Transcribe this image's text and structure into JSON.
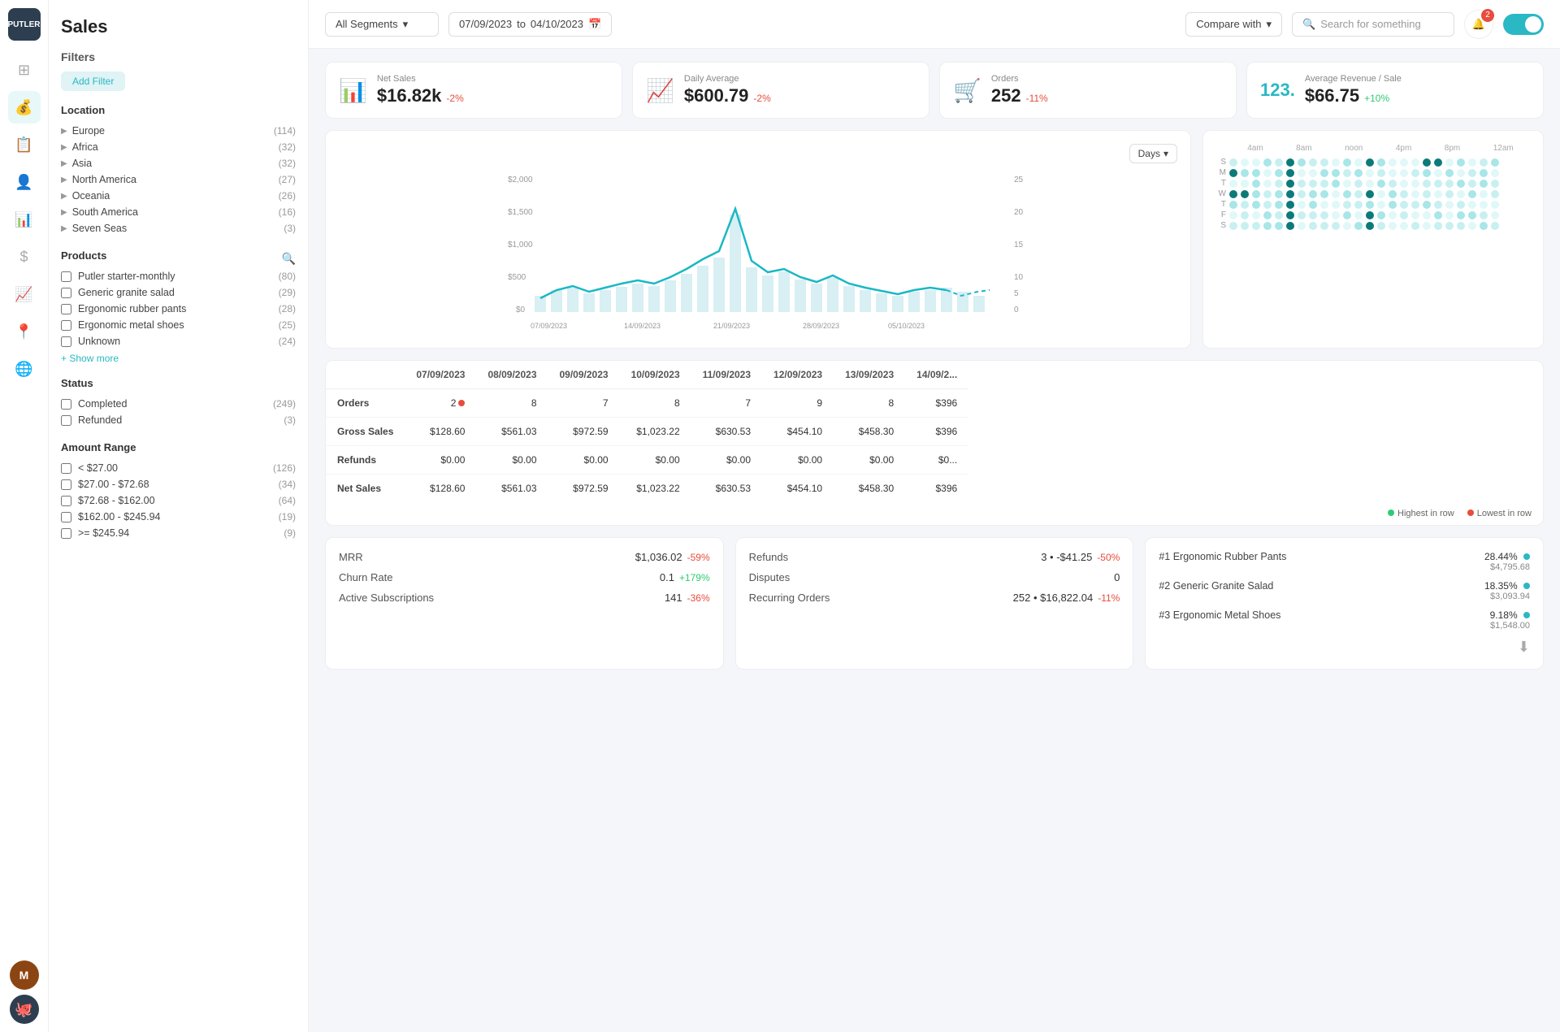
{
  "app": {
    "name": "PUTLER",
    "page_title": "Sales"
  },
  "topbar": {
    "segment_label": "All Segments",
    "date_from": "07/09/2023",
    "date_to": "04/10/2023",
    "compare_label": "Compare with",
    "search_placeholder": "Search for something",
    "notification_count": "2"
  },
  "kpis": [
    {
      "id": "net-sales",
      "label": "Net Sales",
      "value": "$16.82k",
      "change": "-2%",
      "positive": false
    },
    {
      "id": "daily-avg",
      "label": "Daily Average",
      "value": "$600.79",
      "change": "-2%",
      "positive": false
    },
    {
      "id": "orders",
      "label": "Orders",
      "value": "252",
      "change": "-11%",
      "positive": false
    },
    {
      "id": "avg-revenue",
      "label": "Average Revenue / Sale",
      "value": "$66.75",
      "change": "+10%",
      "positive": true
    }
  ],
  "filters": {
    "title": "Filters",
    "add_button": "Add Filter",
    "location": {
      "title": "Location",
      "items": [
        {
          "label": "Europe",
          "count": 114
        },
        {
          "label": "Africa",
          "count": 32
        },
        {
          "label": "Asia",
          "count": 32
        },
        {
          "label": "North America",
          "count": 27
        },
        {
          "label": "Oceania",
          "count": 26
        },
        {
          "label": "South America",
          "count": 16
        },
        {
          "label": "Seven Seas",
          "count": 3
        }
      ]
    },
    "products": {
      "title": "Products",
      "items": [
        {
          "label": "Putler starter-monthly",
          "count": 80
        },
        {
          "label": "Generic granite salad",
          "count": 29
        },
        {
          "label": "Ergonomic rubber pants",
          "count": 28
        },
        {
          "label": "Ergonomic metal shoes",
          "count": 25
        },
        {
          "label": "Unknown",
          "count": 24
        }
      ],
      "show_more": "+ Show more"
    },
    "status": {
      "title": "Status",
      "items": [
        {
          "label": "Completed",
          "count": 249
        },
        {
          "label": "Refunded",
          "count": 3
        }
      ]
    },
    "amount_range": {
      "title": "Amount Range",
      "items": [
        {
          "label": "< $27.00",
          "count": 126
        },
        {
          "label": "$27.00 - $72.68",
          "count": 34
        },
        {
          "label": "$72.68 - $162.00",
          "count": 64
        },
        {
          "label": "$162.00 - $245.94",
          "count": 19
        },
        {
          "label": ">= $245.94",
          "count": 9
        }
      ]
    }
  },
  "chart": {
    "days_button": "Days",
    "x_labels": [
      "07/09/2023",
      "14/09/2023",
      "21/09/2023",
      "28/09/2023",
      "05/10/2023"
    ],
    "y_labels": [
      "$2,000",
      "$1,500",
      "$1,000",
      "$500",
      "$0"
    ],
    "y_right_labels": [
      "25",
      "20",
      "15",
      "10",
      "5",
      "0"
    ]
  },
  "heatmap": {
    "time_labels": [
      "4am",
      "8am",
      "noon",
      "4pm",
      "8pm",
      "12am"
    ],
    "day_labels": [
      "S",
      "M",
      "T",
      "W",
      "T",
      "F",
      "S"
    ]
  },
  "table": {
    "columns": [
      "07/09/2023",
      "08/09/2023",
      "09/09/2023",
      "10/09/2023",
      "11/09/2023",
      "12/09/2023",
      "13/09/2023",
      "14/09/2..."
    ],
    "rows": [
      {
        "label": "Orders",
        "values": [
          "2",
          "8",
          "7",
          "8",
          "7",
          "9",
          "8",
          "$396"
        ]
      },
      {
        "label": "Gross Sales",
        "values": [
          "$128.60",
          "$561.03",
          "$972.59",
          "$1,023.22",
          "$630.53",
          "$454.10",
          "$458.30",
          "$396"
        ]
      },
      {
        "label": "Refunds",
        "values": [
          "$0.00",
          "$0.00",
          "$0.00",
          "$0.00",
          "$0.00",
          "$0.00",
          "$0.00",
          "$0..."
        ]
      },
      {
        "label": "Net Sales",
        "values": [
          "$128.60",
          "$561.03",
          "$972.59",
          "$1,023.22",
          "$630.53",
          "$454.10",
          "$458.30",
          "$396"
        ]
      }
    ],
    "legend": {
      "highest": "Highest in row",
      "lowest": "Lowest in row"
    }
  },
  "metrics_left": {
    "items": [
      {
        "label": "MRR",
        "value": "$1,036.02",
        "change": "-59%",
        "positive": false
      },
      {
        "label": "Churn Rate",
        "value": "0.1",
        "change": "+179%",
        "positive": true
      },
      {
        "label": "Active Subscriptions",
        "value": "141",
        "change": "-36%",
        "positive": false
      }
    ]
  },
  "metrics_right": {
    "items": [
      {
        "label": "Refunds",
        "value": "3 • -$41.25",
        "change": "-50%",
        "positive": false
      },
      {
        "label": "Disputes",
        "value": "0",
        "change": "",
        "positive": false
      },
      {
        "label": "Recurring Orders",
        "value": "252 • $16,822.04",
        "change": "-11%",
        "positive": false
      }
    ]
  },
  "top_products": {
    "items": [
      {
        "rank": "#1",
        "name": "Ergonomic Rubber Pants",
        "pct": "28.44%",
        "value": "$4,795.68"
      },
      {
        "rank": "#2",
        "name": "Generic Granite Salad",
        "pct": "18.35%",
        "value": "$3,093.94"
      },
      {
        "rank": "#3",
        "name": "Ergonomic Metal Shoes",
        "pct": "9.18%",
        "value": "$1,548.00"
      }
    ]
  }
}
